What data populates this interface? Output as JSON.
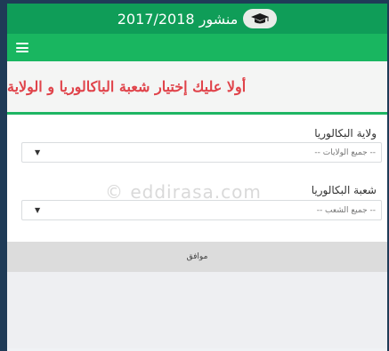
{
  "header": {
    "title": "منشور 2017/2018",
    "logo_icon": "graduation-cap-icon"
  },
  "navbar": {
    "menu_icon": "hamburger-menu-icon"
  },
  "main": {
    "heading": "أولا عليك إختيار شعبة الباكالوريا و الولاية"
  },
  "form": {
    "state_label": "ولاية البكالوريا",
    "state_value": "-- جميع الولايات --",
    "branch_label": "شعبة البكالوريا",
    "branch_value": "-- جميع الشعب --",
    "submit_label": "موافق"
  },
  "watermark": "© eddirasa.com",
  "colors": {
    "top_bar": "#0f9d58",
    "nav_bar": "#19b660",
    "heading_text": "#e0434a",
    "divider": "#1db563",
    "frame": "#1f3b57"
  }
}
